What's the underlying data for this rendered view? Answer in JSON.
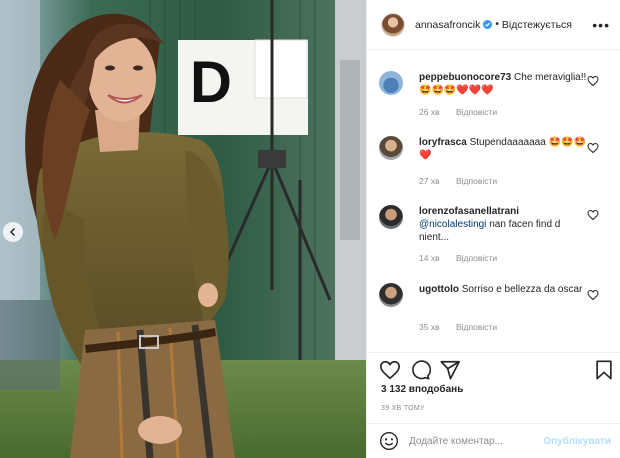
{
  "post": {
    "username": "annasafroncik",
    "follow_label": "Відстежується",
    "separator": "•",
    "more_label": "•••",
    "likes": "3 132 вподобань",
    "time": "39 ХВ ТОМУ"
  },
  "photo": {
    "sign_letter": "D"
  },
  "comments": [
    {
      "user": "peppebuonocore73",
      "text": "Che meraviglia!!🤩🤩🤩❤️❤️❤️",
      "mention": "",
      "age": "26 хв",
      "reply": "Відповісти"
    },
    {
      "user": "loryfrasca",
      "text": "Stupendaaaaaaa 🤩🤩🤩❤️",
      "mention": "",
      "age": "27 хв",
      "reply": "Відповісти"
    },
    {
      "user": "lorenzofasanellatrani",
      "text": " nan facen find d nient...",
      "mention": "@nicolalestingi",
      "age": "14 хв",
      "reply": "Відповісти"
    },
    {
      "user": "ugottolo",
      "text": "Sorriso e bellezza da oscar",
      "mention": "",
      "age": "35 хв",
      "reply": "Відповісти"
    }
  ],
  "add_comment": {
    "placeholder": "Додайте коментар...",
    "post_label": "Опублікувати"
  },
  "colors": {
    "link_blue": "#00376b",
    "post_button_disabled": "#b2dffc",
    "like_red": "#ed4956",
    "verified_blue": "#3897f0"
  },
  "icons": [
    "verified-badge-icon",
    "more-options-icon",
    "heart-icon",
    "comment-icon",
    "share-icon",
    "bookmark-icon",
    "emoji-icon",
    "chevron-left-icon"
  ]
}
